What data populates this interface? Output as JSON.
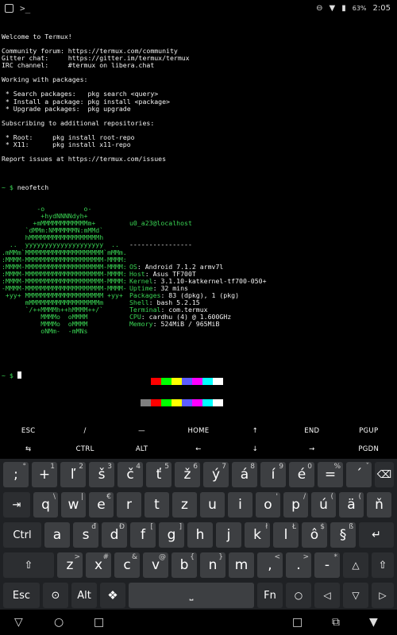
{
  "status": {
    "battery": "63%",
    "time": "2:05"
  },
  "terminal": {
    "welcome": [
      "Welcome to Termux!",
      "",
      "Community forum: https://termux.com/community",
      "Gitter chat:     https://gitter.im/termux/termux",
      "IRC channel:     #termux on libera.chat",
      "",
      "Working with packages:",
      "",
      " * Search packages:   pkg search <query>",
      " * Install a package: pkg install <package>",
      " * Upgrade packages:  pkg upgrade",
      "",
      "Subscribing to additional repositories:",
      "",
      " * Root:     pkg install root-repo",
      " * X11:      pkg install x11-repo",
      "",
      "Report issues at https://termux.com/issues",
      ""
    ],
    "command_prompt": "~ $ ",
    "command": "neofetch",
    "logo": [
      "         -o          o-",
      "          +hydNNNNdyh+",
      "        +mMMMMMMMMMMMMm+",
      "      `dMMm:NMMMMMMN:mMMd`",
      "      hMMMMMMMMMMMMMMMMMMh",
      "  ..  yyyyyyyyyyyyyyyyyyyy  ..",
      ".mMMm`MMMMMMMMMMMMMMMMMMMM`mMMm.",
      ":MMMM-MMMMMMMMMMMMMMMMMMMM-MMMM:",
      ":MMMM-MMMMMMMMMMMMMMMMMMMM-MMMM:",
      ":MMMM-MMMMMMMMMMMMMMMMMMMM-MMMM:",
      ":MMMM-MMMMMMMMMMMMMMMMMMMM-MMMM:",
      "-MMMM-MMMMMMMMMMMMMMMMMMMM-MMMM-",
      " +yy+ MMMMMMMMMMMMMMMMMMMM +yy+",
      "      mMMMMMMMMMMMMMMMMMMm",
      "      `/++MMMMh++hMMMM++/`",
      "          MMMMo  oMMMM",
      "          MMMMo  oMMMM",
      "          oNMm-  -mMNs"
    ],
    "user_host": "u0_a23@localhost",
    "separator": "----------------",
    "info": [
      {
        "label": "OS",
        "value": "Android 7.1.2 armv7l"
      },
      {
        "label": "Host",
        "value": "Asus TF700T"
      },
      {
        "label": "Kernel",
        "value": "3.1.10-katkernel-tf700-050+"
      },
      {
        "label": "Uptime",
        "value": "32 mins"
      },
      {
        "label": "Packages",
        "value": "83 (dpkg), 1 (pkg)"
      },
      {
        "label": "Shell",
        "value": "bash 5.2.15"
      },
      {
        "label": "Terminal",
        "value": "com.termux"
      },
      {
        "label": "CPU",
        "value": "cardhu (4) @ 1.600GHz"
      },
      {
        "label": "Memory",
        "value": "524MiB / 965MiB"
      }
    ],
    "palette_top": [
      "#000000",
      "#ff0000",
      "#00ff00",
      "#ffff00",
      "#5c5cff",
      "#ff00ff",
      "#00ffff",
      "#ffffff"
    ],
    "palette_bottom": [
      "#7f7f7f",
      "#ff0000",
      "#00ff00",
      "#ffff00",
      "#5c5cff",
      "#ff00ff",
      "#00ffff",
      "#ffffff"
    ],
    "final_prompt": "~ $ "
  },
  "extra_keys": {
    "row1": [
      "ESC",
      "/",
      "—",
      "HOME",
      "↑",
      "END",
      "PGUP"
    ],
    "row2": [
      "⇆",
      "CTRL",
      "ALT",
      "←",
      "↓",
      "→",
      "PGDN"
    ]
  },
  "keyboard": {
    "row1": [
      {
        "main": ";",
        "hint": "°"
      },
      {
        "main": "+",
        "hint": "1"
      },
      {
        "main": "ľ",
        "hint": "2"
      },
      {
        "main": "š",
        "hint": "3"
      },
      {
        "main": "č",
        "hint": "4"
      },
      {
        "main": "ť",
        "hint": "5"
      },
      {
        "main": "ž",
        "hint": "6"
      },
      {
        "main": "ý",
        "hint": "7"
      },
      {
        "main": "á",
        "hint": "8"
      },
      {
        "main": "í",
        "hint": "9"
      },
      {
        "main": "é",
        "hint": "0"
      },
      {
        "main": "=",
        "hint": "%"
      },
      {
        "main": "´",
        "hint": "ˇ"
      }
    ],
    "row2": [
      {
        "main": "q",
        "hint": "\\"
      },
      {
        "main": "w",
        "hint": "|"
      },
      {
        "main": "e",
        "hint": "€"
      },
      {
        "main": "r",
        "hint": ""
      },
      {
        "main": "t",
        "hint": ""
      },
      {
        "main": "z",
        "hint": ""
      },
      {
        "main": "u",
        "hint": ""
      },
      {
        "main": "i",
        "hint": ""
      },
      {
        "main": "o",
        "hint": "'"
      },
      {
        "main": "p",
        "hint": "/"
      },
      {
        "main": "ú",
        "hint": "("
      },
      {
        "main": "ä",
        "hint": "("
      },
      {
        "main": "ň",
        "hint": ""
      }
    ],
    "row3": [
      {
        "main": "a",
        "hint": ""
      },
      {
        "main": "s",
        "hint": "đ"
      },
      {
        "main": "d",
        "hint": "Đ"
      },
      {
        "main": "f",
        "hint": "["
      },
      {
        "main": "g",
        "hint": "]"
      },
      {
        "main": "h",
        "hint": ""
      },
      {
        "main": "j",
        "hint": ""
      },
      {
        "main": "k",
        "hint": "ł"
      },
      {
        "main": "l",
        "hint": "Ł"
      },
      {
        "main": "ô",
        "hint": "$"
      },
      {
        "main": "§",
        "hint": "ß"
      }
    ],
    "row4": [
      {
        "main": "z",
        "hint": ">"
      },
      {
        "main": "x",
        "hint": "#"
      },
      {
        "main": "c",
        "hint": "&"
      },
      {
        "main": "v",
        "hint": "@"
      },
      {
        "main": "b",
        "hint": "{"
      },
      {
        "main": "n",
        "hint": "}"
      },
      {
        "main": "m",
        "hint": ""
      },
      {
        "main": ",",
        "hint": "<"
      },
      {
        "main": ".",
        "hint": ">"
      },
      {
        "main": "-",
        "hint": "*"
      }
    ],
    "ctrl_label": "Ctrl",
    "esc_label": "Esc",
    "alt_label": "Alt",
    "fn_label": "Fn"
  }
}
